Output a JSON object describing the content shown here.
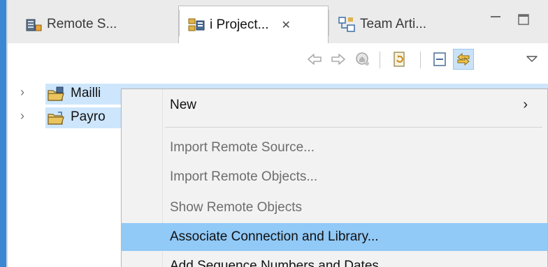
{
  "tabs": [
    {
      "label": "Remote S...",
      "icon": "remote-systems-icon",
      "active": false
    },
    {
      "label": "i Project...",
      "icon": "project-explorer-icon",
      "active": true,
      "close_glyph": "✕"
    },
    {
      "label": "Team Arti...",
      "icon": "team-artifacts-icon",
      "active": false
    }
  ],
  "window_controls": {
    "minimize": "minimize-icon",
    "maximize": "maximize-icon"
  },
  "toolbar": {
    "buttons": [
      "back-icon",
      "forward-icon",
      "home-icon",
      "refresh-icon",
      "collapse-all-icon",
      "link-with-editor-icon",
      "view-menu-icon"
    ]
  },
  "tree": {
    "items": [
      {
        "label": "Mailli",
        "icon": "project-folder-icon",
        "selected": true
      },
      {
        "label": "Payro",
        "icon": "project-folder-icon",
        "selected": true
      }
    ],
    "expand_glyph": "›"
  },
  "context_menu": {
    "items": [
      {
        "label": "New",
        "enabled": true,
        "has_submenu": true,
        "submenu_glyph": "›"
      },
      {
        "label": "Import Remote Source...",
        "enabled": false
      },
      {
        "label": "Import Remote Objects...",
        "enabled": false
      },
      {
        "label": "Show Remote Objects",
        "enabled": false
      },
      {
        "label": "Associate Connection and Library...",
        "enabled": true,
        "highlighted": true
      },
      {
        "label": "Add Sequence Numbers and Dates",
        "enabled": true
      }
    ]
  },
  "colors": {
    "accent": "#3b87d4",
    "selection": "#cde6fb",
    "menu_highlight": "#91c9f7"
  }
}
